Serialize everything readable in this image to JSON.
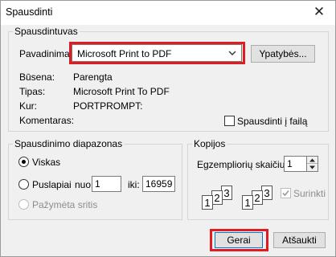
{
  "dialog": {
    "title": "Spausdinti",
    "close_glyph": "✕"
  },
  "printer": {
    "group_label": "Spausdintuvas",
    "name_label": "Pavadinimas:",
    "name_value": "Microsoft Print to PDF",
    "properties_button": "Ypatybės...",
    "status_label": "Būsena:",
    "status_value": "Parengta",
    "type_label": "Tipas:",
    "type_value": "Microsoft Print To PDF",
    "where_label": "Kur:",
    "where_value": "PORTPROMPT:",
    "comment_label": "Komentaras:",
    "print_to_file_label": "Spausdinti į failą",
    "print_to_file_checked": false
  },
  "range": {
    "group_label": "Spausdinimo diapazonas",
    "all_label": "Viskas",
    "pages_label": "Puslapiai",
    "from_label": "nuo:",
    "from_value": "1",
    "to_label": "iki:",
    "to_value": "16959",
    "selection_label": "Pažymėta sritis",
    "selected": "all"
  },
  "copies": {
    "group_label": "Kopijos",
    "count_label": "Egzempliorių skaičius:",
    "count_value": "1",
    "collate_label": "Surinkti",
    "collate_checked": true,
    "collate_enabled": false,
    "icon_a": [
      "1",
      "2",
      "3"
    ],
    "icon_b": [
      "1",
      "2",
      "3"
    ]
  },
  "buttons": {
    "ok": "Gerai",
    "cancel": "Atšaukti"
  },
  "colors": {
    "highlight": "#e11b22",
    "window_bg": "#f0f0f0"
  }
}
